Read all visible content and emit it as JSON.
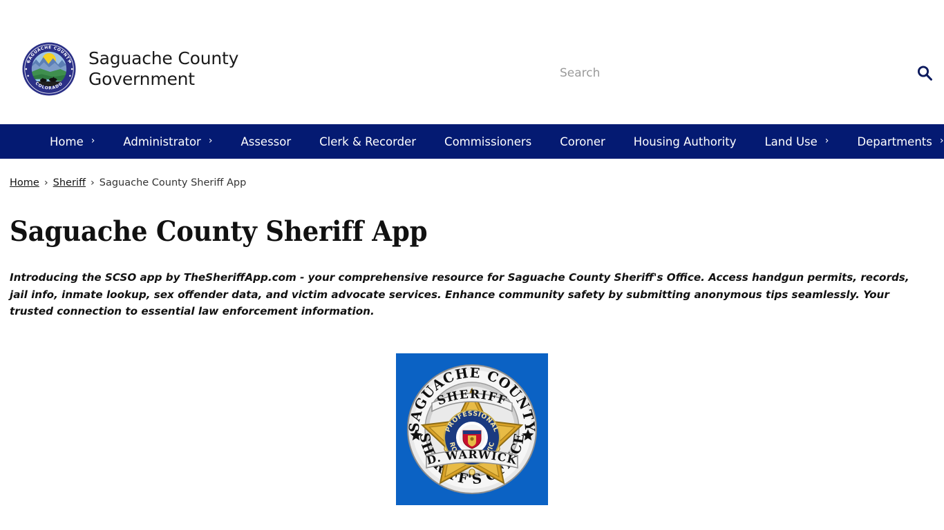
{
  "header": {
    "logo_icon": "saguache-county-seal",
    "seal_text_top": "SAGUACHE COUNTY",
    "seal_text_bottom": "COLORADO",
    "site_title_line1": "Saguache County",
    "site_title_line2": "Government",
    "site_title": "Saguache County Government"
  },
  "search": {
    "placeholder": "Search",
    "value": "",
    "icon": "search-icon",
    "button_label": "Search"
  },
  "nav": {
    "background_color": "#041a72",
    "items": [
      {
        "label": "Home",
        "has_dropdown": true,
        "caret": "›"
      },
      {
        "label": "Administrator",
        "has_dropdown": true,
        "caret": "›"
      },
      {
        "label": "Assessor",
        "has_dropdown": false,
        "caret": ""
      },
      {
        "label": "Clerk & Recorder",
        "has_dropdown": false,
        "caret": ""
      },
      {
        "label": "Commissioners",
        "has_dropdown": false,
        "caret": ""
      },
      {
        "label": "Coroner",
        "has_dropdown": false,
        "caret": ""
      },
      {
        "label": "Housing Authority",
        "has_dropdown": false,
        "caret": ""
      },
      {
        "label": "Land Use",
        "has_dropdown": true,
        "caret": "›"
      },
      {
        "label": "Departments",
        "has_dropdown": true,
        "caret": "›"
      }
    ]
  },
  "breadcrumb": {
    "separator": "›",
    "items": [
      {
        "label": "Home",
        "is_link": true
      },
      {
        "label": "Sheriff",
        "is_link": true
      },
      {
        "label": "Saguache County Sheriff App",
        "is_link": false
      }
    ]
  },
  "main": {
    "title": "Saguache County Sheriff App",
    "intro": "Introducing the SCSO app by TheSheriffApp.com - your comprehensive resource for Saguache County Sheriff's Office. Access handgun permits, records, jail info, inmate lookup, sex offender data, and victim advocate services. Enhance community safety by submitting anonymous tips seamlessly. Your trusted connection to essential law enforcement information.",
    "badge_image": {
      "name": "saguache-county-sheriffs-office-badge",
      "background_color": "#0b62c4",
      "ring_text_top": "SAGUACHE COUNTY",
      "ring_text_bottom": "SHERIFF'S OFFICE",
      "banner_text": "SHERIFF",
      "star_text": "PROMPT PROFESSIONAL SERVICE",
      "name_plate": "D. WARWICK"
    }
  },
  "colors": {
    "nav_navy": "#041a72",
    "badge_blue": "#0b62c4",
    "page_background": "#ffffff",
    "text": "#111111",
    "placeholder": "#9a9a9a"
  }
}
